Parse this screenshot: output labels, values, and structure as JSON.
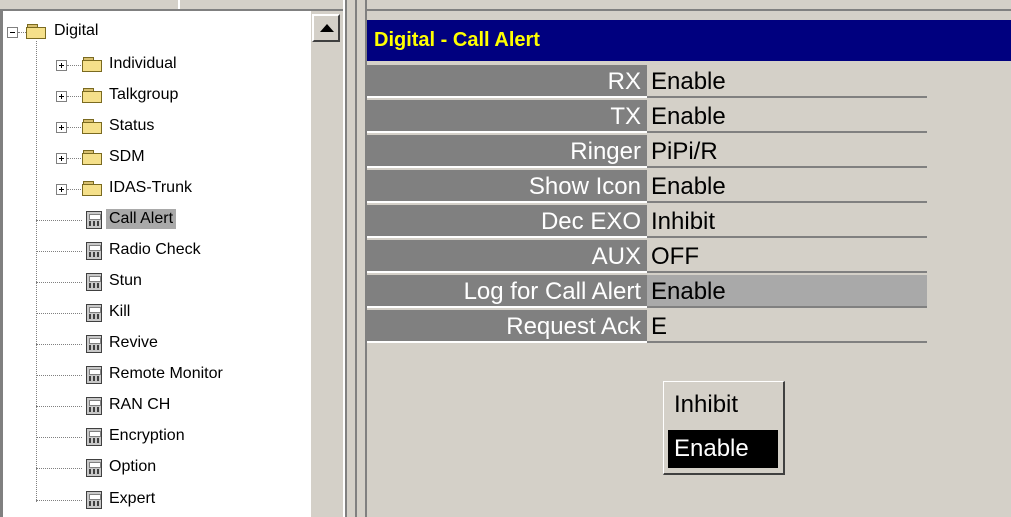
{
  "tree": {
    "root": {
      "label": "Digital",
      "expanded": true
    },
    "folders": [
      {
        "label": "Individual"
      },
      {
        "label": "Talkgroup"
      },
      {
        "label": "Status"
      },
      {
        "label": "SDM"
      },
      {
        "label": "IDAS-Trunk"
      }
    ],
    "items": [
      {
        "label": "Call Alert",
        "selected": true
      },
      {
        "label": "Radio Check"
      },
      {
        "label": "Stun"
      },
      {
        "label": "Kill"
      },
      {
        "label": "Revive"
      },
      {
        "label": "Remote Monitor"
      },
      {
        "label": "RAN CH"
      },
      {
        "label": "Encryption"
      },
      {
        "label": "Option"
      },
      {
        "label": "Expert"
      }
    ]
  },
  "panel": {
    "title": "Digital - Call Alert",
    "rows": [
      {
        "label": "RX",
        "value": "Enable"
      },
      {
        "label": "TX",
        "value": "Enable"
      },
      {
        "label": "Ringer",
        "value": "PiPi/R"
      },
      {
        "label": "Show Icon",
        "value": "Enable"
      },
      {
        "label": "Dec EXO",
        "value": "Inhibit"
      },
      {
        "label": "AUX",
        "value": "OFF"
      },
      {
        "label": "Log for Call Alert",
        "value": "Enable"
      },
      {
        "label": "Request Ack",
        "value": "E"
      }
    ]
  },
  "dropdown": {
    "options": [
      "Inhibit",
      "Enable"
    ],
    "selected": "Enable"
  },
  "colors": {
    "title_bar": "#00007f",
    "title_text": "#ffff00",
    "label_cell": "#808080",
    "highlight": "#a9a9a9"
  }
}
